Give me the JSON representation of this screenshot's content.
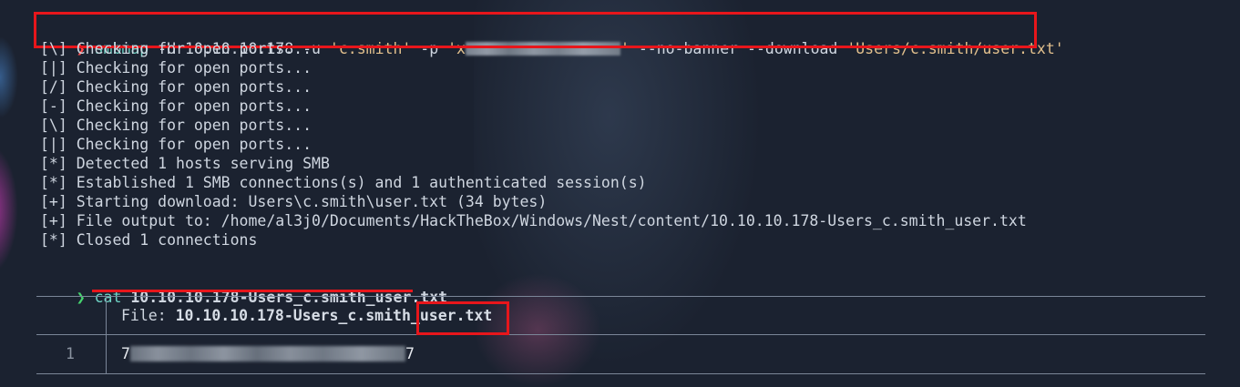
{
  "command1": {
    "prompt_symbol": "❯",
    "program": "smbmap",
    "args_before_secret": " -H 10.10.10.178 -u ",
    "user": "'c.smith'",
    "password_flag": " -p ",
    "password_open": "'x",
    "password_close": "'",
    "args_after_secret": " --no-banner --download ",
    "path_arg": "'Users/c.smith/user.txt'"
  },
  "output_lines": [
    "[\\] Checking for open ports...",
    "[|] Checking for open ports...",
    "[/] Checking for open ports...",
    "[-] Checking for open ports...",
    "[\\] Checking for open ports...",
    "[|] Checking for open ports...",
    "[*] Detected 1 hosts serving SMB",
    "[*] Established 1 SMB connections(s) and 1 authenticated session(s)",
    "[+] Starting download: Users\\c.smith\\user.txt (34 bytes)",
    "[+] File output to: /home/al3j0/Documents/HackTheBox/Windows/Nest/content/10.10.10.178-Users_c.smith_user.txt",
    "[*] Closed 1 connections"
  ],
  "command2": {
    "prompt_symbol": "❯",
    "program": "cat",
    "argument": "10.10.10.178-Users_c.smith_user.txt"
  },
  "bat_view": {
    "file_label": "File: ",
    "file_name_prefix": "10.10.10.178-Users_c.smith_",
    "file_name_suffix": "user.txt",
    "rows": [
      {
        "number": "1",
        "value_start": "7",
        "value_end": "7"
      }
    ]
  },
  "colors": {
    "background": "#1b2230",
    "text": "#cfd6e0",
    "command": "#6fd4c6",
    "string": "#e2c08d",
    "prompt_red": "#ff4b4b",
    "prompt_green": "#45d46e",
    "highlight": "#e8161b"
  }
}
